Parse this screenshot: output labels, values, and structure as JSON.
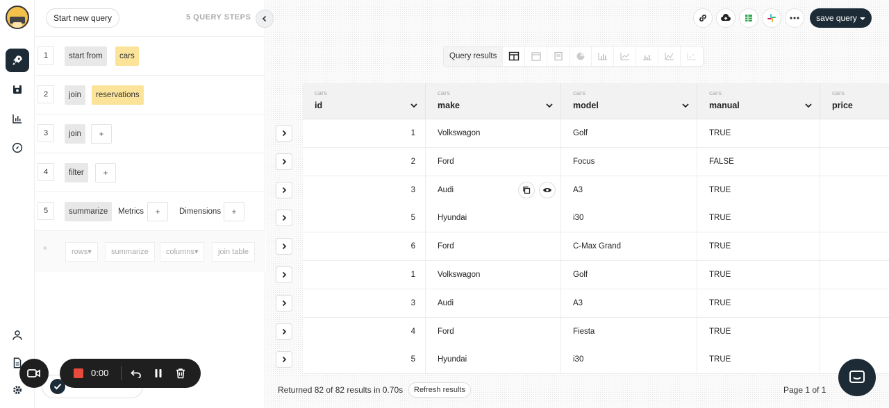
{
  "sidebar": {
    "items": [
      {
        "name": "rocket-icon",
        "active": true
      },
      {
        "name": "save-icon",
        "active": false
      },
      {
        "name": "chart-icon",
        "active": false
      },
      {
        "name": "compass-icon",
        "active": false
      }
    ],
    "bottom_items": [
      {
        "name": "user-icon"
      },
      {
        "name": "document-icon"
      },
      {
        "name": "gear-icon"
      }
    ]
  },
  "steps_panel": {
    "new_query_label": "Start new query",
    "steps_count_label": "5 QUERY STEPS",
    "steps": [
      {
        "number": "1",
        "action": "start from",
        "value": "cars"
      },
      {
        "number": "2",
        "action": "join",
        "value": "reservations"
      },
      {
        "number": "3",
        "action": "join",
        "add": "+"
      },
      {
        "number": "4",
        "action": "filter",
        "add": "+"
      },
      {
        "number": "5",
        "action": "summarize",
        "metrics_label": "Metrics",
        "metrics_add": "+",
        "dimensions_label": "Dimensions",
        "dimensions_add": "+"
      }
    ],
    "add_step": {
      "plus": "+",
      "options": [
        "rows▾",
        "summarize",
        "columns▾",
        "join table"
      ]
    }
  },
  "toolbar": {
    "icons": [
      "link-icon",
      "cloud-upload-icon",
      "sheets-icon",
      "slack-icon",
      "more-icon"
    ],
    "save_label": "save query"
  },
  "view_switcher": {
    "label": "Query results",
    "views": [
      "table-icon",
      "calendar-icon",
      "card-icon",
      "pie-chart-icon",
      "bar-chart-icon",
      "line-chart-icon",
      "column-chart-icon",
      "area-chart-icon",
      "scatter-icon"
    ]
  },
  "table": {
    "columns": [
      {
        "source": "cars",
        "name": "id"
      },
      {
        "source": "cars",
        "name": "make"
      },
      {
        "source": "cars",
        "name": "model"
      },
      {
        "source": "cars",
        "name": "manual"
      },
      {
        "source": "cars",
        "name": "price"
      }
    ],
    "rows": [
      {
        "id": "1",
        "make": "Volkswagon",
        "model": "Golf",
        "manual": "TRUE",
        "price": ""
      },
      {
        "id": "2",
        "make": "Ford",
        "model": "Focus",
        "manual": "FALSE",
        "price": ""
      },
      {
        "id": "3",
        "make": "Audi",
        "model": "A3",
        "manual": "TRUE",
        "price": ""
      },
      {
        "id": "5",
        "make": "Hyundai",
        "model": "i30",
        "manual": "TRUE",
        "price": ""
      },
      {
        "id": "6",
        "make": "Ford",
        "model": "C-Max Grand",
        "manual": "TRUE",
        "price": ""
      },
      {
        "id": "1",
        "make": "Volkswagon",
        "model": "Golf",
        "manual": "TRUE",
        "price": ""
      },
      {
        "id": "3",
        "make": "Audi",
        "model": "A3",
        "manual": "TRUE",
        "price": ""
      },
      {
        "id": "4",
        "make": "Ford",
        "model": "Fiesta",
        "manual": "TRUE",
        "price": ""
      },
      {
        "id": "5",
        "make": "Hyundai",
        "model": "i30",
        "manual": "TRUE",
        "price": ""
      }
    ]
  },
  "footer": {
    "results_text": "Returned 82 of 82 results in 0.70s",
    "refresh_label": "Refresh results",
    "page_text": "Page 1 of 1"
  },
  "recorder": {
    "time": "0:00"
  },
  "colors": {
    "dark": "#1d2b36",
    "chip_yellow": "#fbe49a",
    "chip_gray": "#e8e8e8",
    "record_red": "#e84b3c"
  }
}
